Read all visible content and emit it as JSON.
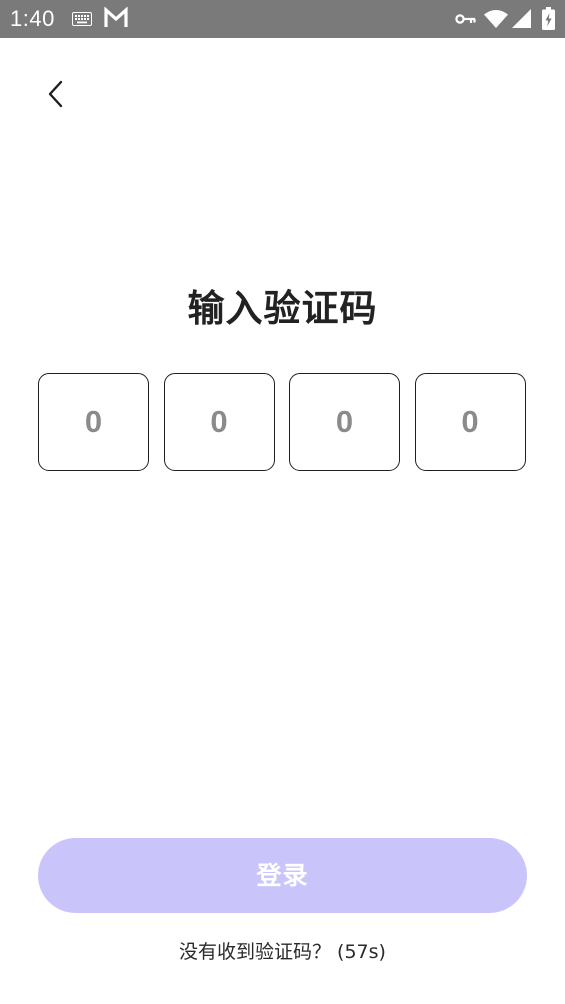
{
  "status_bar": {
    "time": "1:40",
    "icons": [
      "keyboard-icon",
      "gmail-icon",
      "vpn-key-icon",
      "wifi-icon",
      "signal-icon",
      "battery-charging-icon"
    ]
  },
  "nav": {
    "back_icon": "chevron-left-icon"
  },
  "main": {
    "title": "输入验证码",
    "code_digits": [
      "0",
      "0",
      "0",
      "0"
    ]
  },
  "login_button": {
    "label": "登录",
    "color": "#c9c5fa"
  },
  "resend": {
    "prompt": "没有收到验证码？",
    "countdown": "(57s)"
  },
  "colors": {
    "status_bar_bg": "#7a7a7a",
    "box_border": "#1f1f1f",
    "digit_text": "#8b8b8b"
  }
}
